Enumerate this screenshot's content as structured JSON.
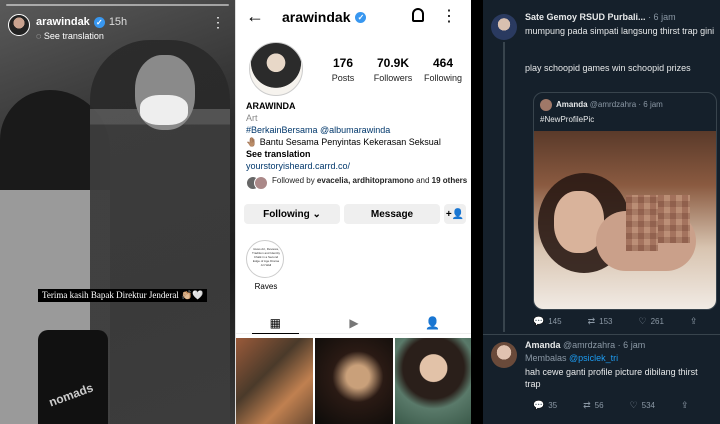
{
  "story": {
    "username": "arawindak",
    "time": "15h",
    "translation": "See translation",
    "caption": "Terima kasih Bapak Direktur Jenderal 👏🏼🤍",
    "bag_text": "nomads",
    "more": "⋮"
  },
  "instagram": {
    "back": "←",
    "username": "arawindak",
    "more": "⋮",
    "stats": [
      {
        "value": "176",
        "label": "Posts"
      },
      {
        "value": "70.9K",
        "label": "Followers"
      },
      {
        "value": "464",
        "label": "Following"
      }
    ],
    "bio": {
      "name": "ARAWINDA",
      "category": "Art",
      "line1": "#BerkainBersama @albumarawinda",
      "line2": "🤚🏽 Bantu Sesama Penyintas Kekerasan Seksual",
      "translation": "See translation",
      "link": "yourstoryisheard.carrd.co/"
    },
    "followed_by": {
      "prefix": "Followed by",
      "names": "evacelia, ardhitopramono",
      "suffix": "and",
      "count": "19 others"
    },
    "buttons": {
      "following": "Following ⌄",
      "message": "Message",
      "add": "+👤"
    },
    "highlight": {
      "label": "Raves",
      "inner": "rAves Art, Reviews, Tradition and Identity Chalk in a Second Edge of Age Drama Art Wall"
    },
    "tabs": [
      "▦",
      "▶",
      "👤"
    ]
  },
  "twitter": {
    "tweet1": {
      "name": "Sate Gemoy RSUD Purbali...",
      "time": "· 6 jam",
      "line1": "mumpung pada simpati langsung thirst trap gini",
      "line2": "play schoopid games win schoopid prizes"
    },
    "quote": {
      "name": "Amanda",
      "handle": "@amrdzahra · 6 jam",
      "text": "#NewProfilePic"
    },
    "actions1": [
      {
        "icon": "💬",
        "count": "145"
      },
      {
        "icon": "⇄",
        "count": "153"
      },
      {
        "icon": "♡",
        "count": "261"
      },
      {
        "icon": "⇪",
        "count": ""
      }
    ],
    "tweet2": {
      "name": "Amanda",
      "handle": "@amrdzahra · 6 jam",
      "reply_prefix": "Membalas",
      "reply_to": "@psiclek_tri",
      "text": "hah cewe ganti profile picture dibilang thirst trap"
    },
    "actions2": [
      {
        "icon": "💬",
        "count": "35"
      },
      {
        "icon": "⇄",
        "count": "56"
      },
      {
        "icon": "♡",
        "count": "534"
      },
      {
        "icon": "⇪",
        "count": ""
      }
    ],
    "colors": {
      "bg": "#15202b",
      "link": "#1d9bf0",
      "muted": "#8b98a5"
    }
  }
}
